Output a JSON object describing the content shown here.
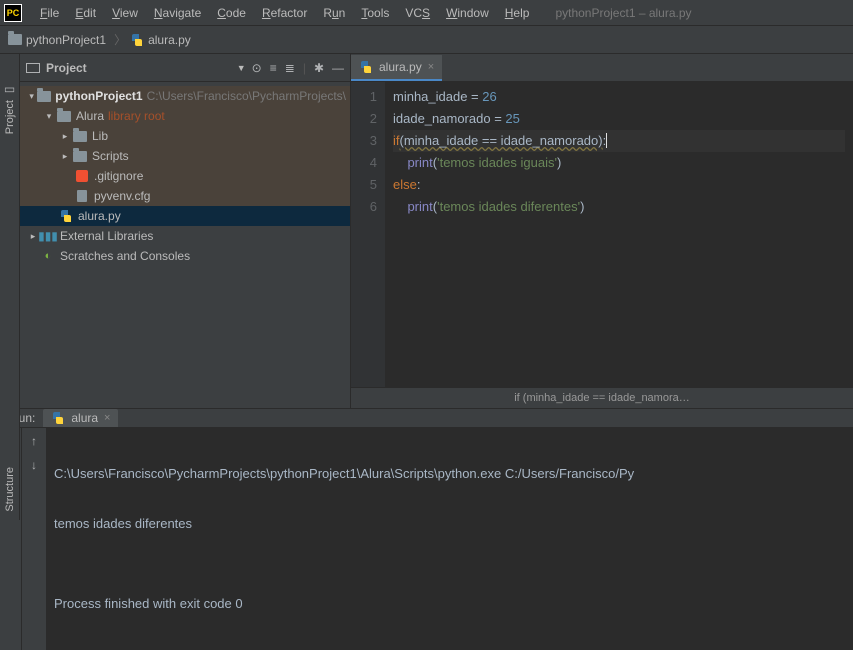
{
  "app": {
    "title": "pythonProject1 – alura.py",
    "icon_text": "PC"
  },
  "menu": {
    "file": "File",
    "edit": "Edit",
    "view": "View",
    "navigate": "Navigate",
    "code": "Code",
    "refactor": "Refactor",
    "run": "Run",
    "tools": "Tools",
    "vcs": "VCS",
    "window": "Window",
    "help": "Help"
  },
  "breadcrumbs": {
    "project": "pythonProject1",
    "file": "alura.py"
  },
  "sidebar": {
    "project_label": "Project",
    "structure_label": "Structure"
  },
  "project_panel": {
    "title": "Project"
  },
  "tree": {
    "root": {
      "name": "pythonProject1",
      "path": "C:\\Users\\Francisco\\PycharmProjects\\"
    },
    "alura_folder": {
      "name": "Alura",
      "tag": "library root"
    },
    "lib": "Lib",
    "scripts": "Scripts",
    "gitignore": ".gitignore",
    "pyvenv": "pyvenv.cfg",
    "alura_py": "alura.py",
    "external": "External Libraries",
    "scratches": "Scratches and Consoles"
  },
  "editor": {
    "tab": "alura.py",
    "lines": [
      "1",
      "2",
      "3",
      "4",
      "5",
      "6"
    ],
    "code": {
      "l1": {
        "a": "minha_idade = ",
        "b": "26"
      },
      "l2": {
        "a": "idade_namorado = ",
        "b": "25"
      },
      "l3": {
        "a": "if",
        "b": "(minha_idade == idade_namorado)",
        "c": ":"
      },
      "l4": {
        "a": "    ",
        "b": "print",
        "c": "(",
        "d": "'temos idades iguais'",
        "e": ")"
      },
      "l5": {
        "a": "else",
        "b": ":"
      },
      "l6": {
        "a": "    ",
        "b": "print",
        "c": "(",
        "d": "'temos idades diferentes'",
        "e": ")"
      }
    },
    "status": "if (minha_idade == idade_namora…"
  },
  "run": {
    "label": "Run:",
    "tab": "alura",
    "console": [
      "C:\\Users\\Francisco\\PycharmProjects\\pythonProject1\\Alura\\Scripts\\python.exe C:/Users/Francisco/Py",
      "temos idades diferentes",
      "",
      "Process finished with exit code 0"
    ]
  }
}
